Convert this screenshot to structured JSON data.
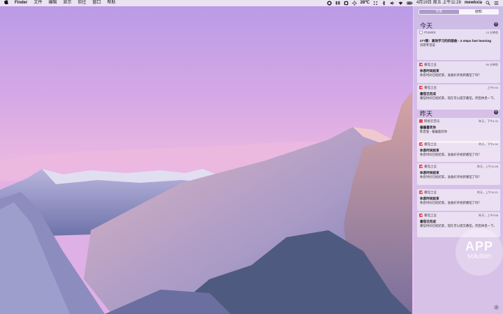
{
  "menubar": {
    "app_name": "Finder",
    "menus": [
      "文件",
      "编辑",
      "显示",
      "前往",
      "窗口",
      "帮助"
    ],
    "temperature": "28℃",
    "datetime": "4月19日 周五 上午11:28",
    "username": "mewkxia",
    "status_icons": [
      "evernote-icon",
      "dropbox-icon",
      "box-icon",
      "weather-icon",
      "bluetooth-icon",
      "volume-icon",
      "wifi-icon",
      "battery-icon",
      "search-icon",
      "list-icon"
    ]
  },
  "notification_center": {
    "tabs": {
      "today": "今天",
      "notifications": "通知"
    },
    "sections": [
      {
        "title": "今天",
        "cards": [
          {
            "app": "ITUNES",
            "time": "13 分钟前",
            "title": "277期：高效学习的四部曲 - 4 steps fast learning",
            "body": "刘雨专话说"
          },
          {
            "app": "番茄土豆",
            "time": "59 分钟前",
            "title": "休息时间结束",
            "body": "休息时间已经结束，准备好开始新番茄了吗？"
          },
          {
            "app": "番茄土豆",
            "time": "上午9:44",
            "title": "番茄已完成",
            "body": "番茄时间已经结束，现在可以提交番茄，然后休息一下。"
          }
        ]
      },
      {
        "title": "昨天",
        "cards": [
          {
            "app": "网易云音乐",
            "time": "昨天，下午4:32",
            "title": "偏偏喜欢你",
            "body": "陈百强 - 偏偏喜欢你"
          },
          {
            "app": "番茄土豆",
            "time": "昨天，下午4:32",
            "title": "休息时间结束",
            "body": "休息时间已经结束，准备好开始新番茄了吗？"
          },
          {
            "app": "番茄土豆",
            "time": "昨天，上午10:28",
            "title": "休息时间结束",
            "body": "休息时间已经结束，准备好开始新番茄了吗？"
          },
          {
            "app": "番茄土豆",
            "time": "昨天，上午10:21",
            "title": "休息时间结束",
            "body": "休息时间已经结束，准备好开始新番茄了吗？"
          },
          {
            "app": "番茄土豆",
            "time": "昨天，上午9:58",
            "title": "番茄已完成",
            "body": "番茄时间已经结束，现在可以提交番茄，然后休息一下。"
          }
        ]
      }
    ]
  },
  "watermark": {
    "line1": "APP",
    "line2": "solution"
  },
  "colors": {
    "tomato_red": "#e8464a",
    "sky_top": "#c7a4e2",
    "sky_pink": "#e9b6e0"
  }
}
